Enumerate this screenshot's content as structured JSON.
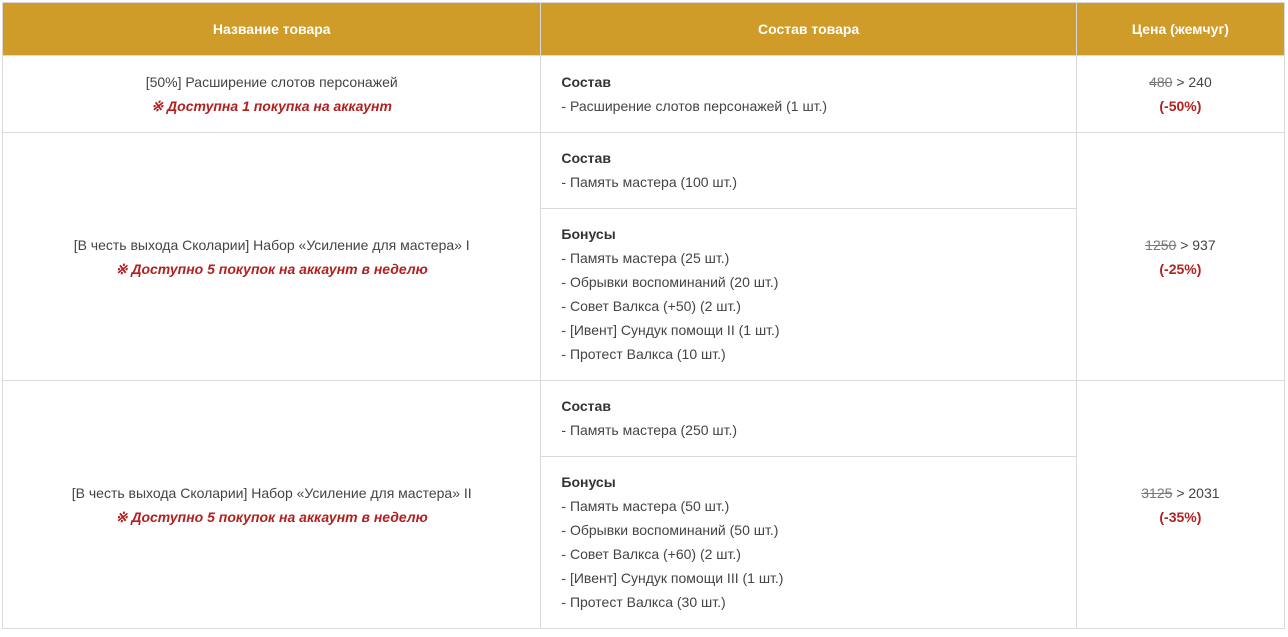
{
  "headers": {
    "name": "Название товара",
    "composition": "Состав товара",
    "price": "Цена (жемчуг)"
  },
  "rows": [
    {
      "name": "[50%] Расширение слотов персонажей",
      "limit_mark": "※",
      "limit": "Доступна 1 покупка на аккаунт",
      "sections": [
        {
          "title": "Состав",
          "items": [
            "- Расширение слотов персонажей (1 шт.)"
          ]
        }
      ],
      "old_price": "480",
      "new_price": "> 240",
      "discount": "(-50%)"
    },
    {
      "name": "[В честь выхода Сколарии] Набор «Усиление для мастера» I",
      "limit_mark": "※",
      "limit": "Доступно 5 покупок на аккаунт в неделю",
      "sections": [
        {
          "title": "Состав",
          "items": [
            "- Память мастера (100 шт.)"
          ]
        },
        {
          "title": "Бонусы",
          "items": [
            "- Память мастера (25 шт.)",
            "- Обрывки воспоминаний (20 шт.)",
            "- Совет Валкса (+50) (2 шт.)",
            "- [Ивент] Сундук помощи II (1 шт.)",
            "- Протест Валкса (10 шт.)"
          ]
        }
      ],
      "old_price": "1250",
      "new_price": "> 937",
      "discount": "(-25%)"
    },
    {
      "name": "[В честь выхода Сколарии] Набор «Усиление для мастера» II",
      "limit_mark": "※",
      "limit": "Доступно 5 покупок на аккаунт в неделю",
      "sections": [
        {
          "title": "Состав",
          "items": [
            "- Память мастера (250 шт.)"
          ]
        },
        {
          "title": "Бонусы",
          "items": [
            "- Память мастера (50 шт.)",
            "- Обрывки воспоминаний (50 шт.)",
            "- Совет Валкса (+60) (2 шт.)",
            "- [Ивент] Сундук помощи III (1 шт.)",
            "- Протест Валкса (30 шт.)"
          ]
        }
      ],
      "old_price": "3125",
      "new_price": "> 2031",
      "discount": "(-35%)"
    }
  ],
  "colors": {
    "header_bg": "#cf9b29",
    "header_text": "#ffffff",
    "warning": "#b22020",
    "border": "#d9d9d9"
  }
}
